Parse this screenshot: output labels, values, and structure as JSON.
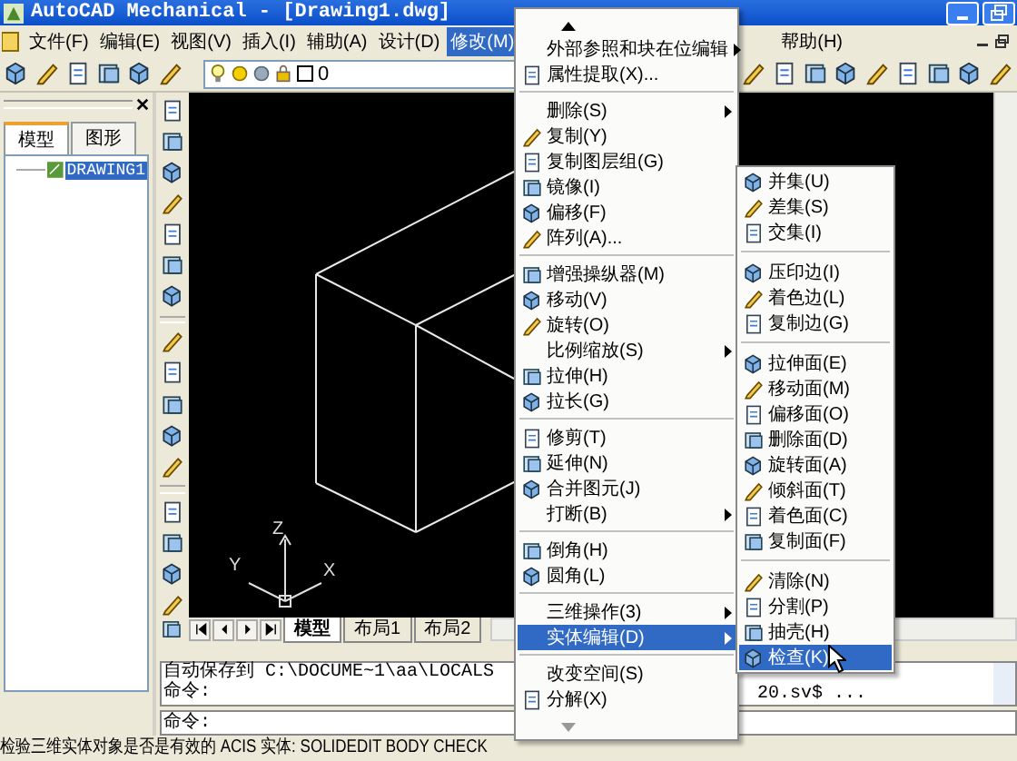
{
  "window": {
    "title": "AutoCAD Mechanical - [Drawing1.dwg]"
  },
  "menu_bar": [
    {
      "label": "文件(F)",
      "selected": false
    },
    {
      "label": "编辑(E)",
      "selected": false
    },
    {
      "label": "视图(V)",
      "selected": false
    },
    {
      "label": "插入(I)",
      "selected": false
    },
    {
      "label": "辅助(A)",
      "selected": false
    },
    {
      "label": "设计(D)",
      "selected": false
    },
    {
      "label": "修改(M)",
      "selected": true
    },
    {
      "label": "帮助(H)",
      "selected": false
    }
  ],
  "toolbar": {
    "layer": "0"
  },
  "panel": {
    "tabs": [
      {
        "label": "模型",
        "selected": true
      },
      {
        "label": "图形",
        "selected": false
      }
    ],
    "tree": [
      {
        "label": "DRAWING1",
        "selected": true
      }
    ]
  },
  "canvas": {
    "axis_labels": [
      "Z",
      "Y",
      "X"
    ]
  },
  "layout_tabs": [
    {
      "label": "模型",
      "selected": true
    },
    {
      "label": "布局1",
      "selected": false
    },
    {
      "label": "布局2",
      "selected": false
    }
  ],
  "command": {
    "history": [
      "自动保存到 C:\\DOCUME~1\\aa\\LOCALS",
      "命令:"
    ],
    "history_tail": "20.sv$ ...",
    "prompt": "命令:"
  },
  "status_text": "检验三维实体对象是否是有效的 ACIS 实体:  SOLIDEDIT BODY CHECK",
  "menu": {
    "items": [
      {
        "kind": "scroll_up"
      },
      {
        "kind": "item",
        "label": "外部参照和块在位编辑",
        "icon": false,
        "submenu": true,
        "selected": false
      },
      {
        "kind": "item",
        "label": "属性提取(X)...",
        "icon": true,
        "submenu": false,
        "selected": false
      },
      {
        "kind": "separator"
      },
      {
        "kind": "item",
        "label": "删除(S)",
        "icon": false,
        "submenu": true,
        "selected": false
      },
      {
        "kind": "item",
        "label": "复制(Y)",
        "icon": true,
        "submenu": false,
        "selected": false
      },
      {
        "kind": "item",
        "label": "复制图层组(G)",
        "icon": true,
        "submenu": false,
        "selected": false
      },
      {
        "kind": "item",
        "label": "镜像(I)",
        "icon": true,
        "submenu": false,
        "selected": false
      },
      {
        "kind": "item",
        "label": "偏移(F)",
        "icon": true,
        "submenu": false,
        "selected": false
      },
      {
        "kind": "item",
        "label": "阵列(A)...",
        "icon": true,
        "submenu": false,
        "selected": false
      },
      {
        "kind": "separator"
      },
      {
        "kind": "item",
        "label": "增强操纵器(M)",
        "icon": true,
        "submenu": false,
        "selected": false
      },
      {
        "kind": "item",
        "label": "移动(V)",
        "icon": true,
        "submenu": false,
        "selected": false
      },
      {
        "kind": "item",
        "label": "旋转(O)",
        "icon": true,
        "submenu": false,
        "selected": false
      },
      {
        "kind": "item",
        "label": "比例缩放(S)",
        "icon": false,
        "submenu": true,
        "selected": false
      },
      {
        "kind": "item",
        "label": "拉伸(H)",
        "icon": true,
        "submenu": false,
        "selected": false
      },
      {
        "kind": "item",
        "label": "拉长(G)",
        "icon": true,
        "submenu": false,
        "selected": false
      },
      {
        "kind": "separator"
      },
      {
        "kind": "item",
        "label": "修剪(T)",
        "icon": true,
        "submenu": false,
        "selected": false
      },
      {
        "kind": "item",
        "label": "延伸(N)",
        "icon": true,
        "submenu": false,
        "selected": false
      },
      {
        "kind": "item",
        "label": "合并图元(J)",
        "icon": true,
        "submenu": false,
        "selected": false
      },
      {
        "kind": "item",
        "label": "打断(B)",
        "icon": false,
        "submenu": true,
        "selected": false
      },
      {
        "kind": "separator"
      },
      {
        "kind": "item",
        "label": "倒角(H)",
        "icon": true,
        "submenu": false,
        "selected": false
      },
      {
        "kind": "item",
        "label": "圆角(L)",
        "icon": true,
        "submenu": false,
        "selected": false
      },
      {
        "kind": "separator"
      },
      {
        "kind": "item",
        "label": "三维操作(3)",
        "icon": false,
        "submenu": true,
        "selected": false
      },
      {
        "kind": "item",
        "label": "实体编辑(D)",
        "icon": false,
        "submenu": true,
        "selected": true
      },
      {
        "kind": "separator"
      },
      {
        "kind": "item",
        "label": "改变空间(S)",
        "icon": false,
        "submenu": false,
        "selected": false
      },
      {
        "kind": "item",
        "label": "分解(X)",
        "icon": true,
        "submenu": false,
        "selected": false
      },
      {
        "kind": "scroll_down"
      }
    ]
  },
  "submenu": {
    "items": [
      {
        "kind": "item",
        "label": "并集(U)",
        "icon": true,
        "selected": false
      },
      {
        "kind": "item",
        "label": "差集(S)",
        "icon": true,
        "selected": false
      },
      {
        "kind": "item",
        "label": "交集(I)",
        "icon": true,
        "selected": false
      },
      {
        "kind": "separator"
      },
      {
        "kind": "item",
        "label": "压印边(I)",
        "icon": true,
        "selected": false
      },
      {
        "kind": "item",
        "label": "着色边(L)",
        "icon": true,
        "selected": false
      },
      {
        "kind": "item",
        "label": "复制边(G)",
        "icon": true,
        "selected": false
      },
      {
        "kind": "separator"
      },
      {
        "kind": "item",
        "label": "拉伸面(E)",
        "icon": true,
        "selected": false
      },
      {
        "kind": "item",
        "label": "移动面(M)",
        "icon": true,
        "selected": false
      },
      {
        "kind": "item",
        "label": "偏移面(O)",
        "icon": true,
        "selected": false
      },
      {
        "kind": "item",
        "label": "删除面(D)",
        "icon": true,
        "selected": false
      },
      {
        "kind": "item",
        "label": "旋转面(A)",
        "icon": true,
        "selected": false
      },
      {
        "kind": "item",
        "label": "倾斜面(T)",
        "icon": true,
        "selected": false
      },
      {
        "kind": "item",
        "label": "着色面(C)",
        "icon": true,
        "selected": false
      },
      {
        "kind": "item",
        "label": "复制面(F)",
        "icon": true,
        "selected": false
      },
      {
        "kind": "separator"
      },
      {
        "kind": "item",
        "label": "清除(N)",
        "icon": true,
        "selected": false
      },
      {
        "kind": "item",
        "label": "分割(P)",
        "icon": true,
        "selected": false
      },
      {
        "kind": "item",
        "label": "抽壳(H)",
        "icon": true,
        "selected": false
      },
      {
        "kind": "item",
        "label": "检查(K)",
        "icon": true,
        "selected": true
      }
    ]
  }
}
